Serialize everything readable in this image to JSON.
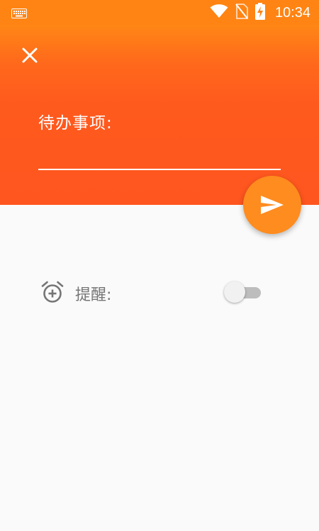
{
  "status_bar": {
    "time": "10:34",
    "icons": [
      "keyboard-icon",
      "wifi-icon",
      "no-sim-icon",
      "battery-charging-icon"
    ]
  },
  "header": {
    "close_icon": "close-icon",
    "todo_label": "待办事项:",
    "todo_input_value": "",
    "todo_input_placeholder": ""
  },
  "fab": {
    "icon": "send-icon"
  },
  "reminder": {
    "icon": "alarm-add-icon",
    "label": "提醒:",
    "enabled": false
  },
  "colors": {
    "header_top": "#ff8616",
    "header_bottom": "#ff561f",
    "fab": "#ff8c1e",
    "background": "#fafafa",
    "label_gray": "#757575"
  }
}
